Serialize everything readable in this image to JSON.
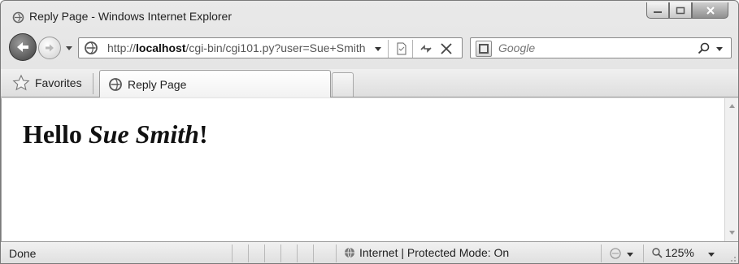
{
  "window": {
    "title": "Reply Page - Windows Internet Explorer"
  },
  "address_bar": {
    "url_prefix": "http://",
    "url_host": "localhost",
    "url_path": "/cgi-bin/cgi101.py?user=Sue+Smith"
  },
  "search": {
    "placeholder": "Google"
  },
  "tabs": {
    "favorites_label": "Favorites",
    "active_tab_label": "Reply Page"
  },
  "page": {
    "greeting": "Hello",
    "user_name": "Sue Smith",
    "punctuation": "!"
  },
  "status_bar": {
    "status": "Done",
    "zone": "Internet | Protected Mode: On",
    "zoom": "125%"
  },
  "colors": {
    "chrome": "#dedede",
    "content_bg": "#ffffff",
    "heading_text": "#111111"
  }
}
